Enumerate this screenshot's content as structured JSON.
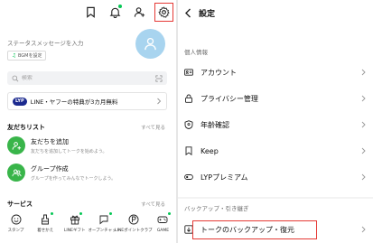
{
  "left": {
    "status_message": "ステータスメッセージを入力",
    "bgm_label": "BGMを設定",
    "search_placeholder": "検索",
    "promo": {
      "badge": "LYP",
      "text": "LINE・ヤフーの特典が3カ月無料"
    },
    "friends": {
      "title": "友だちリスト",
      "see_all": "すべて見る",
      "items": [
        {
          "title": "友だちを追加",
          "sub": "友だちを追加してトークを始めよう。"
        },
        {
          "title": "グループ作成",
          "sub": "グループを作ってみんなでトークしよう。"
        }
      ]
    },
    "services": {
      "title": "サービス",
      "see_all": "すべて見る",
      "items": [
        {
          "label": "スタンプ",
          "icon": "smile-icon"
        },
        {
          "label": "着せかえ",
          "icon": "brush-icon"
        },
        {
          "label": "LINEギフト",
          "icon": "gift-icon"
        },
        {
          "label": "オープンチャット",
          "icon": "open-chat-icon"
        },
        {
          "label": "LINEポイントクラブ",
          "icon": "points-icon"
        },
        {
          "label": "GAME",
          "icon": "game-icon"
        }
      ]
    },
    "top_icons": [
      "bookmark-icon",
      "bell-icon",
      "add-friend-icon",
      "gear-icon"
    ]
  },
  "right": {
    "title": "設定",
    "sections": [
      {
        "title": "個人情報",
        "rows": [
          {
            "label": "アカウント",
            "icon": "id-card-icon"
          },
          {
            "label": "プライバシー管理",
            "icon": "lock-icon"
          },
          {
            "label": "年齢確認",
            "icon": "shield-icon"
          },
          {
            "label": "Keep",
            "icon": "bookmark-icon"
          },
          {
            "label": "LYPプレミアム",
            "icon": "premium-icon"
          }
        ]
      },
      {
        "title": "バックアップ・引き継ぎ",
        "rows": [
          {
            "label": "トークのバックアップ・復元",
            "icon": "backup-icon"
          }
        ]
      }
    ]
  },
  "colors": {
    "accent_green": "#06c755",
    "highlight_red": "#e53935",
    "avatar_blue": "#a8d4ef",
    "lyp_navy": "#1c2a8f"
  }
}
